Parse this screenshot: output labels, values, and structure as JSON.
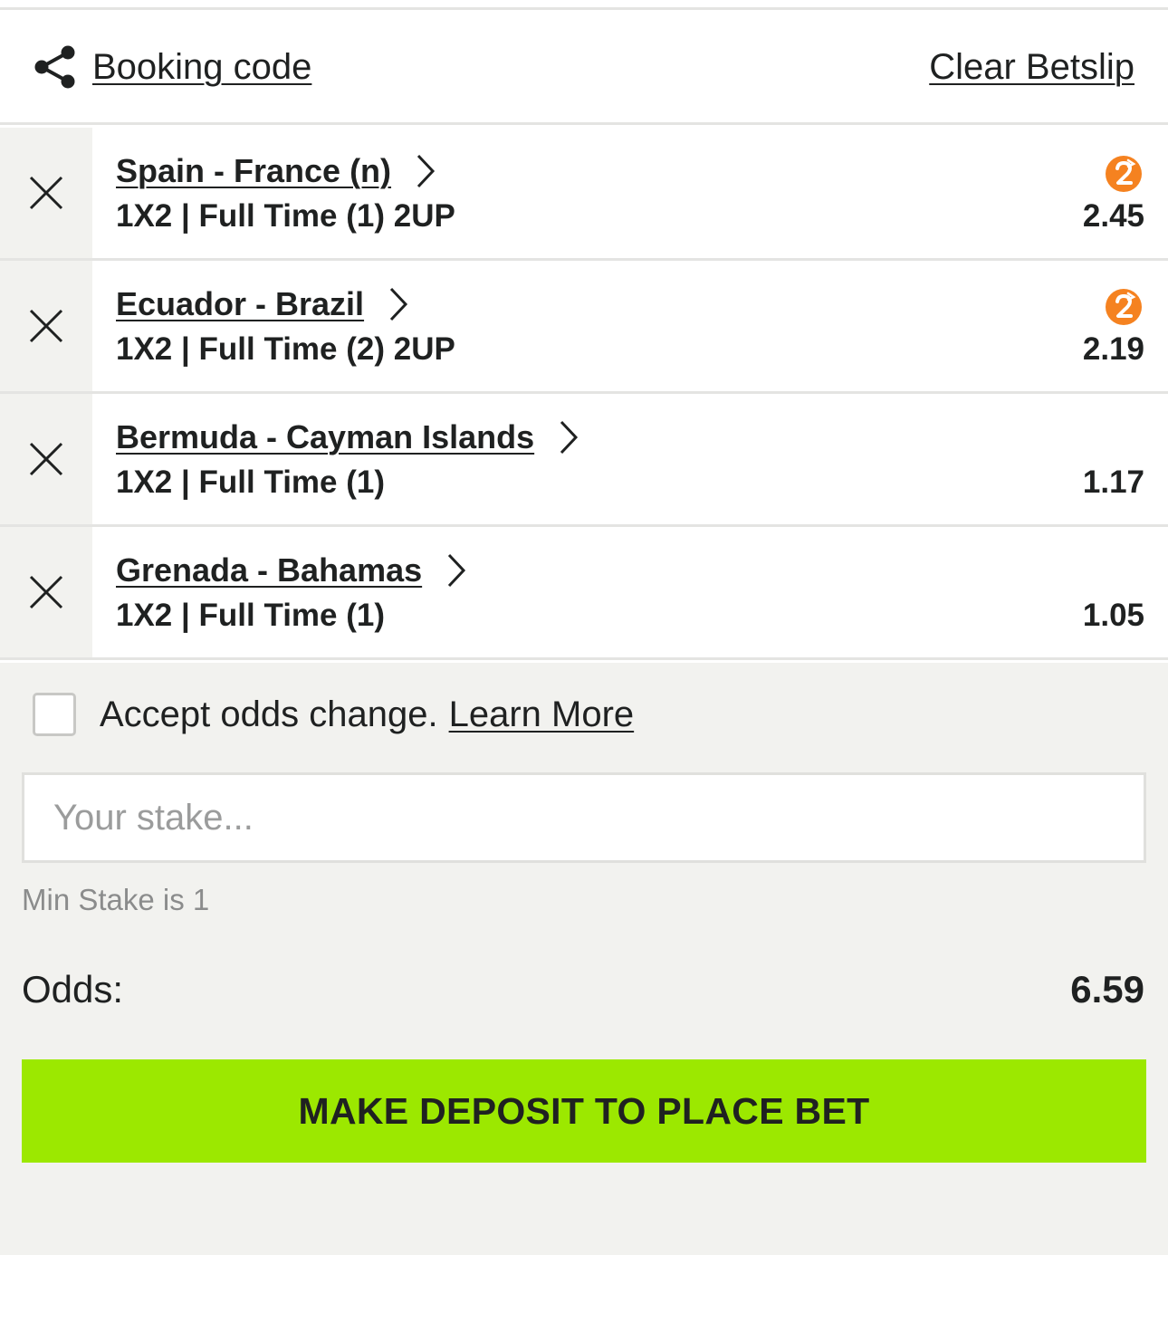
{
  "header": {
    "booking_code_label": "Booking code",
    "share_icon": "share-icon",
    "clear_betslip_label": "Clear Betslip"
  },
  "selections": [
    {
      "match": "Spain - France (n)",
      "market": "1X2 | Full Time (1) 2UP",
      "odd": "2.45",
      "boost_badge": true
    },
    {
      "match": "Ecuador - Brazil",
      "market": "1X2 | Full Time (2) 2UP",
      "odd": "2.19",
      "boost_badge": true
    },
    {
      "match": "Bermuda - Cayman Islands",
      "market": "1X2 | Full Time (1)",
      "odd": "1.17",
      "boost_badge": false
    },
    {
      "match": "Grenada - Bahamas",
      "market": "1X2 | Full Time (1)",
      "odd": "1.05",
      "boost_badge": false
    }
  ],
  "footer": {
    "accept_odds_label": "Accept odds change.",
    "learn_more_label": "Learn More",
    "accept_checked": false,
    "stake_placeholder": "Your stake...",
    "stake_value": "",
    "min_stake_text": "Min Stake is 1",
    "odds_label": "Odds:",
    "odds_total": "6.59",
    "deposit_button_label": "MAKE DEPOSIT TO PLACE BET"
  },
  "colors": {
    "accent_green": "#9ce800",
    "boost_orange": "#f58220",
    "text_dark": "#1f2121",
    "panel_gray": "#f2f2ef",
    "divider": "#e4e4e2"
  }
}
